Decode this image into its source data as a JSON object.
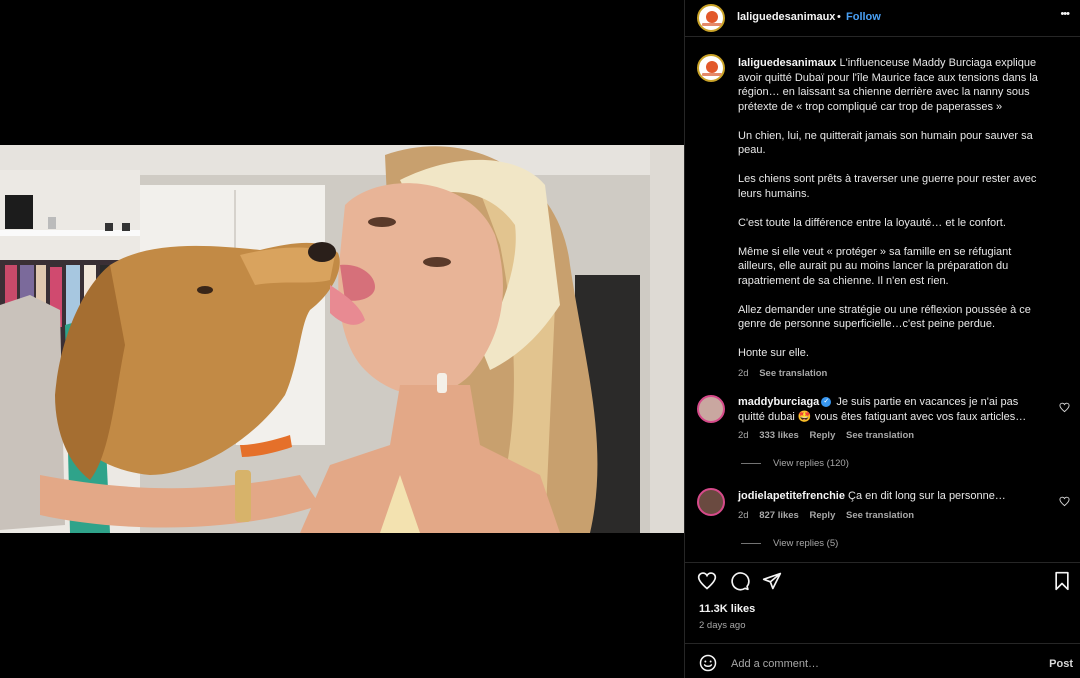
{
  "post": {
    "author": "laliguedesanimaux",
    "follow_label": "Follow",
    "separator": "•",
    "more_label": "•••"
  },
  "caption": {
    "username": "laliguedesanimaux",
    "paragraphs": [
      "L'influenceuse Maddy Burciaga explique avoir quitté Dubaï pour l'île Maurice face aux tensions dans la région… en laissant sa chienne derrière avec la nanny sous prétexte de « trop compliqué car trop de paperasses »",
      "Un chien, lui, ne quitterait jamais son humain pour sauver sa peau.",
      "Les chiens sont prêts à traverser une guerre pour rester avec leurs humains.",
      "C'est toute la différence entre la loyauté… et le confort.",
      "Même si elle veut « protéger » sa famille en se réfugiant ailleurs, elle aurait pu au moins lancer la préparation du rapatriement de sa chienne. Il n'en est rien.",
      "Allez demander une stratégie ou une réflexion poussée à ce genre de personne superficielle…c'est peine perdue.",
      "Honte sur elle."
    ],
    "time": "2d",
    "see_translation": "See translation"
  },
  "comments": [
    {
      "username": "maddyburciaga",
      "text": "Je suis partie en vacances je n'ai pas quitté dubai 🤩 vous êtes fatiguant avec vos faux articles…",
      "time": "2d",
      "likes": "333 likes",
      "reply": "Reply",
      "see_translation": "See translation",
      "view_replies": "View replies (120)"
    },
    {
      "username": "jodielapetitefrenchie",
      "text": "Ça en dit long sur la personne…",
      "time": "2d",
      "likes": "827 likes",
      "reply": "Reply",
      "see_translation": "See translation",
      "view_replies": "View replies (5)"
    }
  ],
  "stats": {
    "likes": "11.3K likes",
    "time_ago": "2 days ago"
  },
  "add_comment": {
    "placeholder": "Add a comment…",
    "post_label": "Post"
  },
  "colors": {
    "background": "#000000",
    "follow_blue": "#4aa0f5",
    "muted": "#a8a8a8",
    "verified": "#3897f0"
  }
}
